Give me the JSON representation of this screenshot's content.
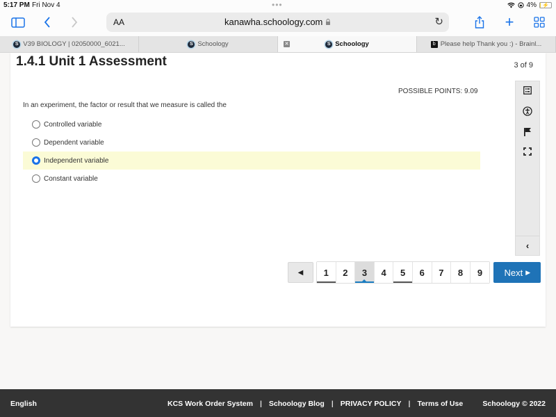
{
  "statusbar": {
    "time": "5:17 PM",
    "date": "Fri Nov 4",
    "battery_percent": "4%",
    "battery_level": 0.04
  },
  "browser": {
    "text_size_label": "AA",
    "url": "kanawha.schoology.com",
    "icons": {
      "sidebar": "sidebar-icon",
      "back": "chevron-left-icon",
      "forward": "chevron-right-icon",
      "lock": "lock-icon",
      "reload": "reload-icon",
      "share": "share-icon",
      "new_tab": "plus-icon",
      "tabs": "tab-grid-icon"
    }
  },
  "tabs": [
    {
      "label": "V39 BIOLOGY | 02050000_6021...",
      "icon": "schoology-logo",
      "active": false
    },
    {
      "label": "Schoology",
      "icon": "schoology-logo",
      "active": false
    },
    {
      "label": "Schoology",
      "icon": "schoology-logo",
      "active": true
    },
    {
      "label": "Please help Thank you :) - Brainl...",
      "icon": "brainly-logo",
      "active": false
    }
  ],
  "assessment": {
    "title": "1.4.1 Unit 1 Assessment",
    "counter": "3 of 9",
    "possible_points": "POSSIBLE POINTS: 9.09",
    "question": "In an experiment, the factor or result that we measure is called the",
    "options": [
      {
        "label": "Controlled variable",
        "selected": false
      },
      {
        "label": "Dependent variable",
        "selected": false
      },
      {
        "label": "Independent variable",
        "selected": true
      },
      {
        "label": "Constant variable",
        "selected": false
      }
    ]
  },
  "side_panel": {
    "icons": [
      "question-list-icon",
      "accessibility-icon",
      "flag-icon",
      "fullscreen-icon"
    ],
    "collapse_icon": "chevron-left-icon"
  },
  "pager": {
    "pages": [
      {
        "label": "1",
        "answered": true
      },
      {
        "label": "2",
        "answered": false
      },
      {
        "label": "3",
        "answered": false,
        "current": true
      },
      {
        "label": "4",
        "answered": false
      },
      {
        "label": "5",
        "answered": true
      },
      {
        "label": "6",
        "answered": false
      },
      {
        "label": "7",
        "answered": false
      },
      {
        "label": "8",
        "answered": false
      },
      {
        "label": "9",
        "answered": false
      }
    ],
    "next_label": "Next"
  },
  "footer": {
    "language": "English",
    "links": [
      "KCS Work Order System",
      "Schoology Blog",
      "PRIVACY POLICY",
      "Terms of Use"
    ],
    "separator": "|",
    "copyright": "Schoology © 2022"
  },
  "colors": {
    "accent": "#1f73b7",
    "selected_option_bg": "#fbfbd6",
    "footer_bg": "#333333"
  }
}
